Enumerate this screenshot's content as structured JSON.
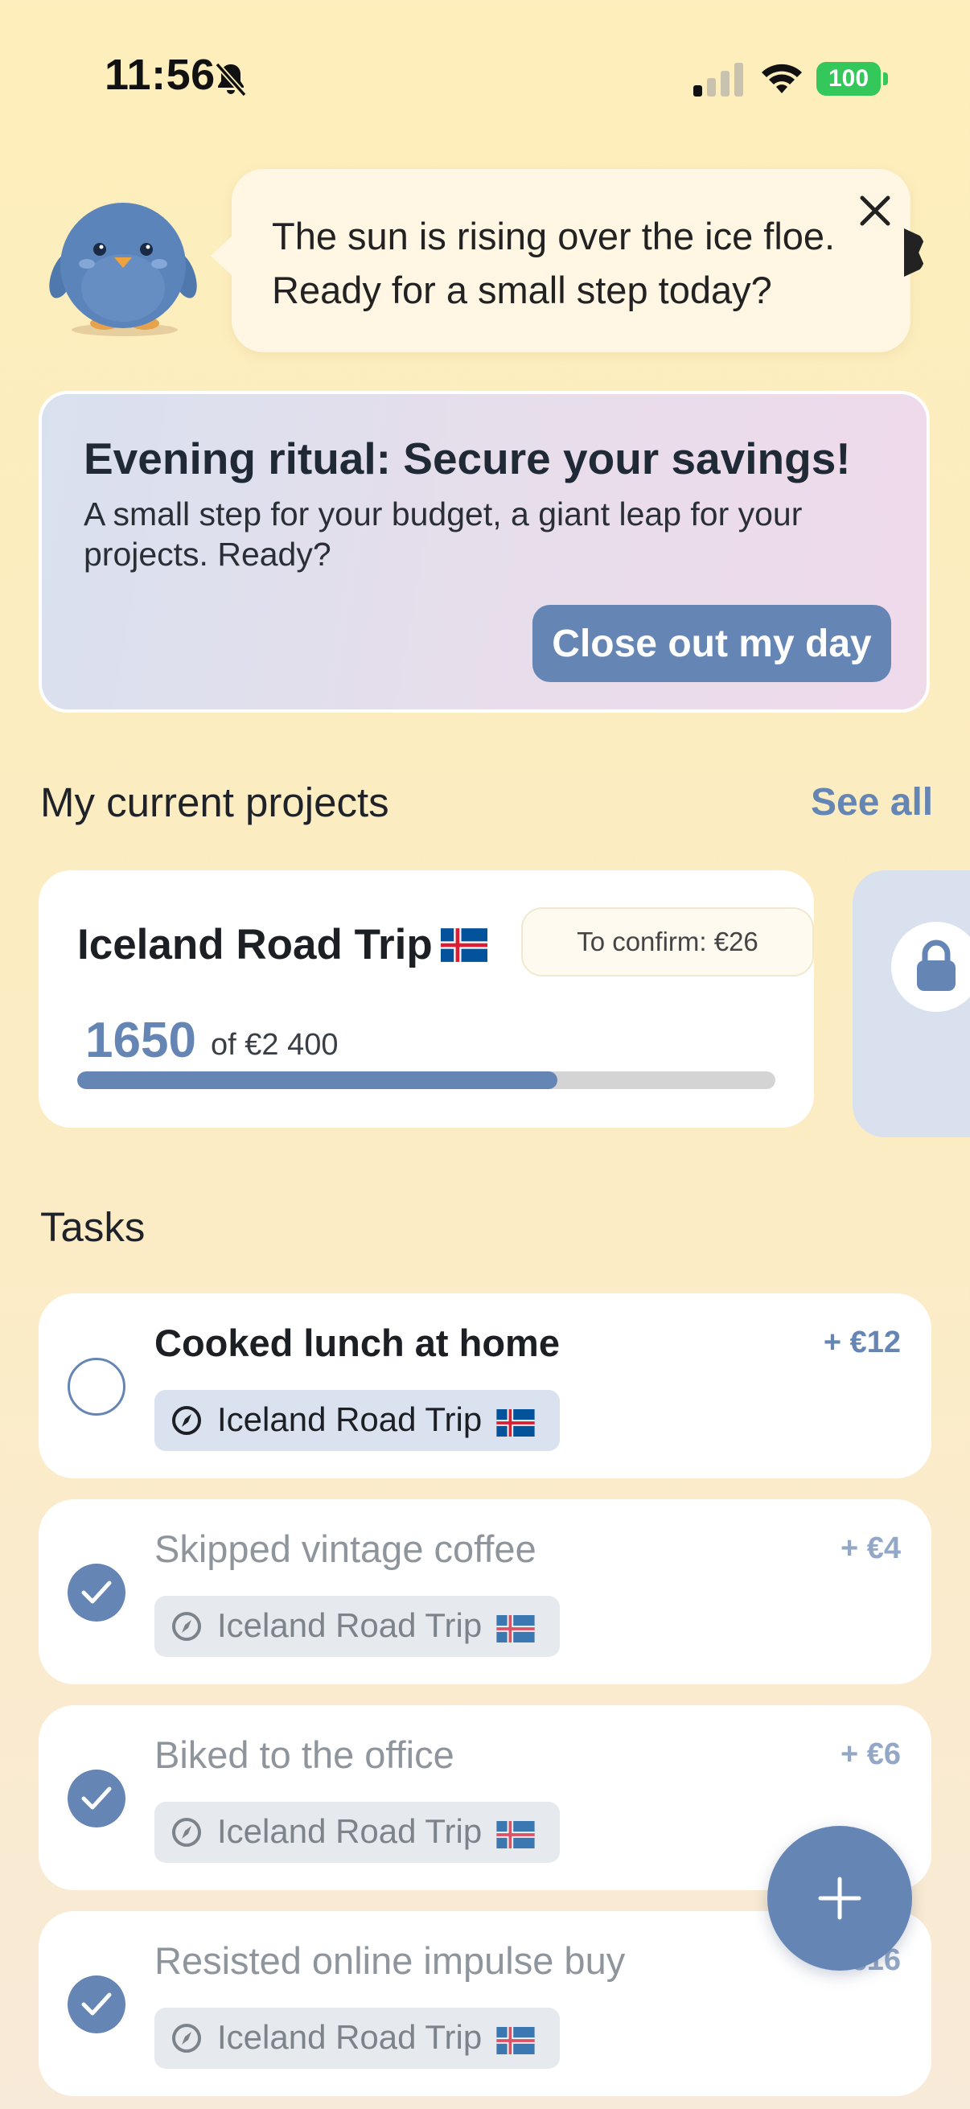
{
  "status_bar": {
    "time": "11:56",
    "battery": "100",
    "icons": [
      "bell-slash-icon",
      "cellular-signal-icon",
      "wifi-icon",
      "battery-icon"
    ]
  },
  "mascot": {
    "icon": "penguin-mascot",
    "message": "The sun is rising over the ice floe. Ready for a small step today?"
  },
  "ritual_card": {
    "title": "Evening ritual: Secure your savings!",
    "subtitle": "A small step for your budget, a giant leap for your projects. Ready?",
    "button_label": "Close out my day"
  },
  "projects": {
    "section_title": "My current projects",
    "see_all_label": "See all",
    "items": [
      {
        "name": "Iceland Road Trip",
        "flag": "iceland-flag-icon",
        "confirm_badge": "To confirm: €26",
        "amount": "1650",
        "of_label": "of €2 400",
        "progress": 0.6875
      },
      {
        "locked": true,
        "icon": "lock-icon"
      }
    ]
  },
  "tasks": {
    "section_title": "Tasks",
    "items": [
      {
        "title": "Cooked lunch at home",
        "amount": "+ €12",
        "tag": "Iceland Road Trip",
        "done": false
      },
      {
        "title": "Skipped vintage coffee",
        "amount": "+ €4",
        "tag": "Iceland Road Trip",
        "done": true
      },
      {
        "title": "Biked to the office",
        "amount": "+ €6",
        "tag": "Iceland Road Trip",
        "done": true
      },
      {
        "title": "Resisted online impulse buy",
        "amount": "+ €16",
        "tag": "Iceland Road Trip",
        "done": true
      }
    ]
  },
  "fab": {
    "icon": "plus-icon"
  },
  "colors": {
    "accent": "#6585b5",
    "background": "#fdeebb",
    "battery": "#34c759"
  }
}
